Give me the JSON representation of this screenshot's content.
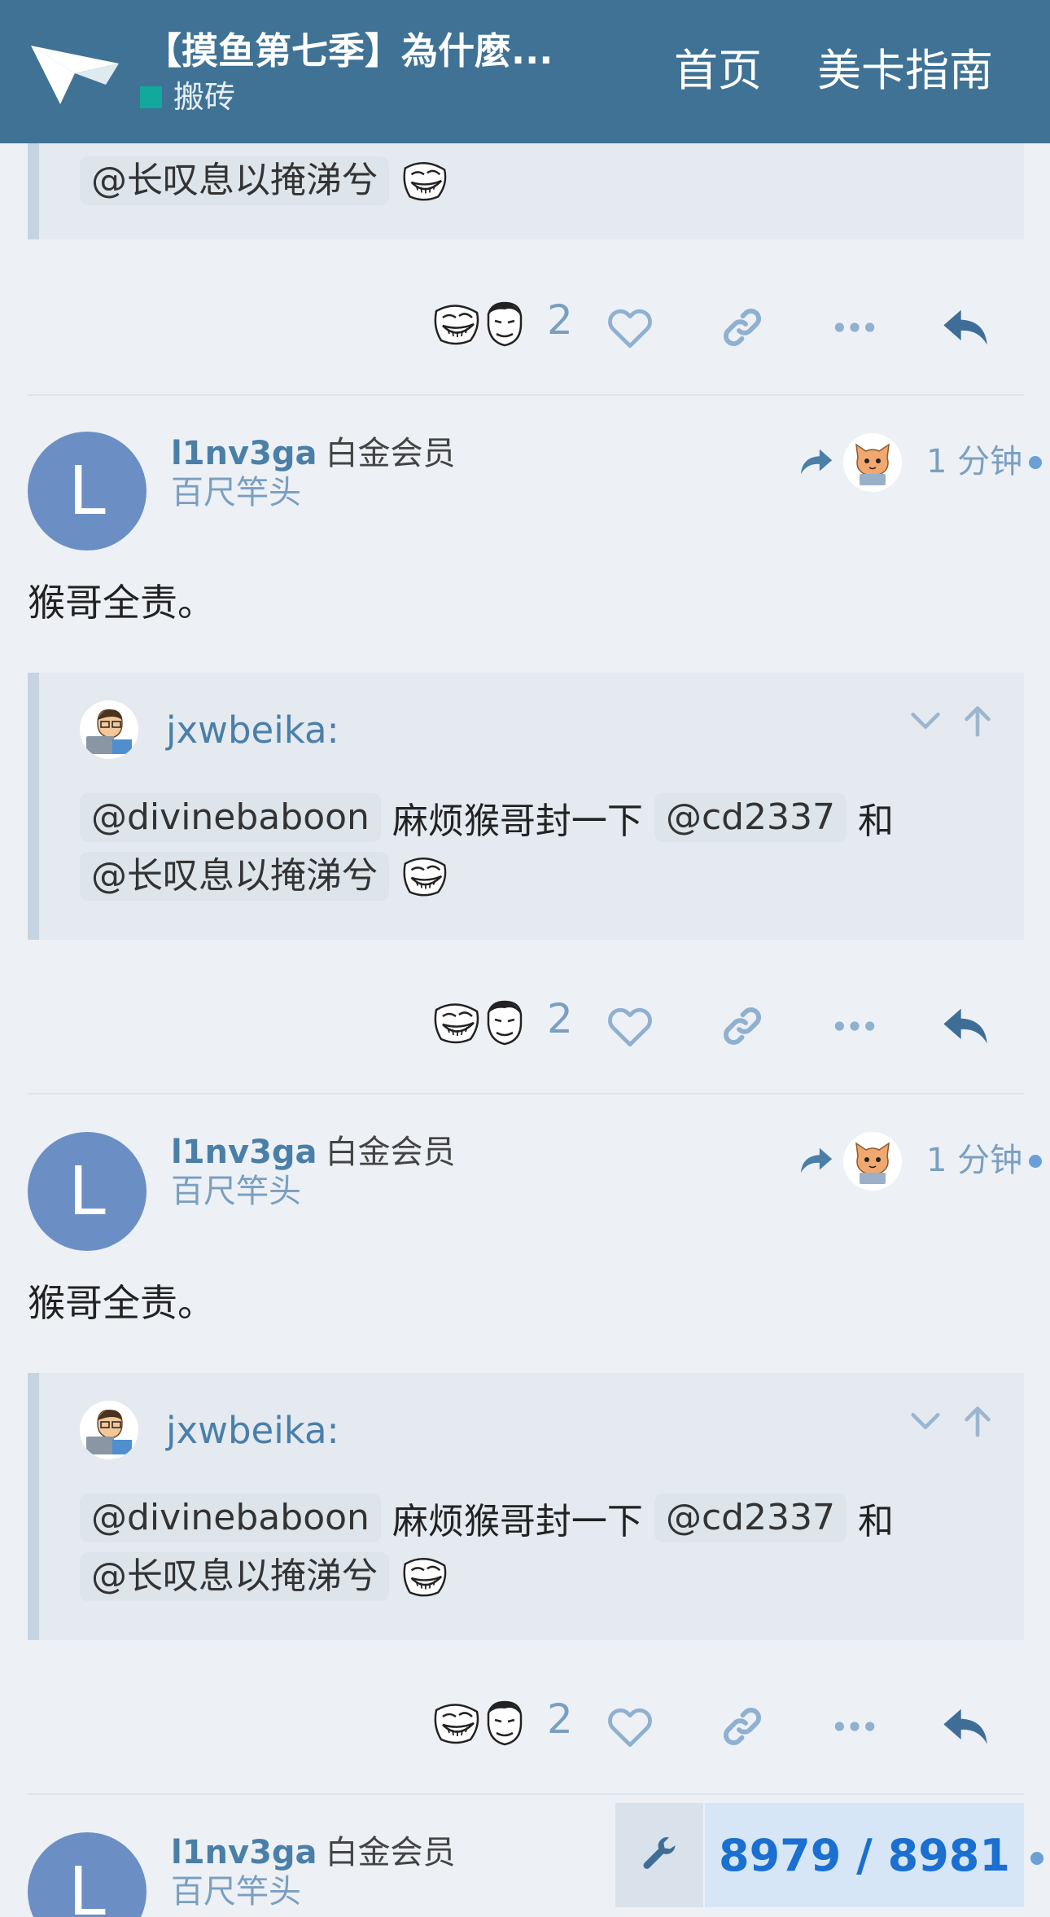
{
  "header": {
    "topic_title": "【摸鱼第七季】為什麼...",
    "category": "搬砖",
    "category_color": "#12a89d",
    "nav": {
      "home": "首页",
      "guide": "美卡指南"
    },
    "bg_color": "#3f7295"
  },
  "quote": {
    "username": "jxwbeika:",
    "mention_1": "@divinebaboon",
    "text_1": "麻烦猴哥封一下",
    "mention_2": "@cd2337",
    "text_2": "和",
    "mention_3": "@长叹息以掩涕兮"
  },
  "reactions": {
    "count": "2"
  },
  "posts": [
    {
      "avatar_letter": "L",
      "username": "l1nv3ga",
      "user_title": "白金会员",
      "flair": "百尺竿头",
      "time": "1 分钟",
      "body": "猴哥全责。"
    },
    {
      "avatar_letter": "L",
      "username": "l1nv3ga",
      "user_title": "白金会员",
      "flair": "百尺竿头",
      "time": "1 分钟",
      "body": "猴哥全责。"
    },
    {
      "avatar_letter": "L",
      "username": "l1nv3ga",
      "user_title": "白金会员",
      "flair": "百尺竿头"
    }
  ],
  "progress": {
    "label": "8979 / 8981"
  },
  "icons": {
    "logo": "paper-plane-logo",
    "reply_to": "share-arrow-icon",
    "like": "heart-icon",
    "link": "link-icon",
    "more": "ellipsis-icon",
    "reply": "reply-icon",
    "collapse": "chevron-down-icon",
    "jump": "arrow-up-icon",
    "admin": "wrench-icon"
  }
}
